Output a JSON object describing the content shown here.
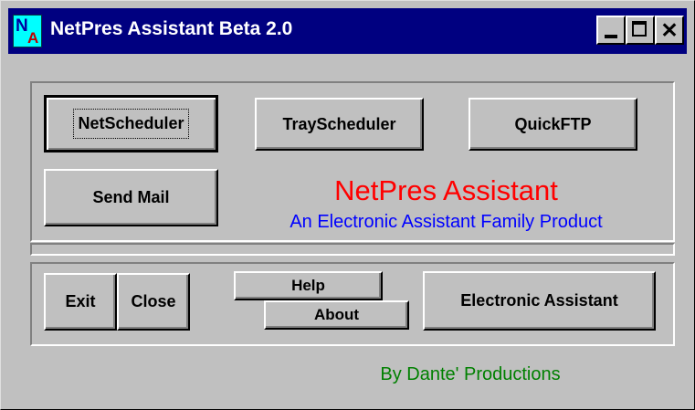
{
  "window": {
    "title": "NetPres Assistant Beta 2.0",
    "icon": {
      "letter1": "N",
      "letter2": "A"
    },
    "controls": {
      "minimize": "minimize-icon",
      "maximize": "maximize-icon",
      "close": "close-icon"
    }
  },
  "buttons": {
    "net_scheduler": "NetScheduler",
    "tray_scheduler": "TrayScheduler",
    "quick_ftp": "QuickFTP",
    "send_mail": "Send Mail",
    "exit": "Exit",
    "close": "Close",
    "help": "Help",
    "about": "About",
    "electronic_assistant": "Electronic Assistant"
  },
  "branding": {
    "title": "NetPres Assistant",
    "subtitle": "An Electronic Assistant Family Product",
    "credit": "By Dante' Productions"
  },
  "colors": {
    "titlebar": "#000080",
    "face": "#c0c0c0",
    "brand_title": "#ff0000",
    "brand_subtitle": "#0000ff",
    "credit": "#008000"
  }
}
